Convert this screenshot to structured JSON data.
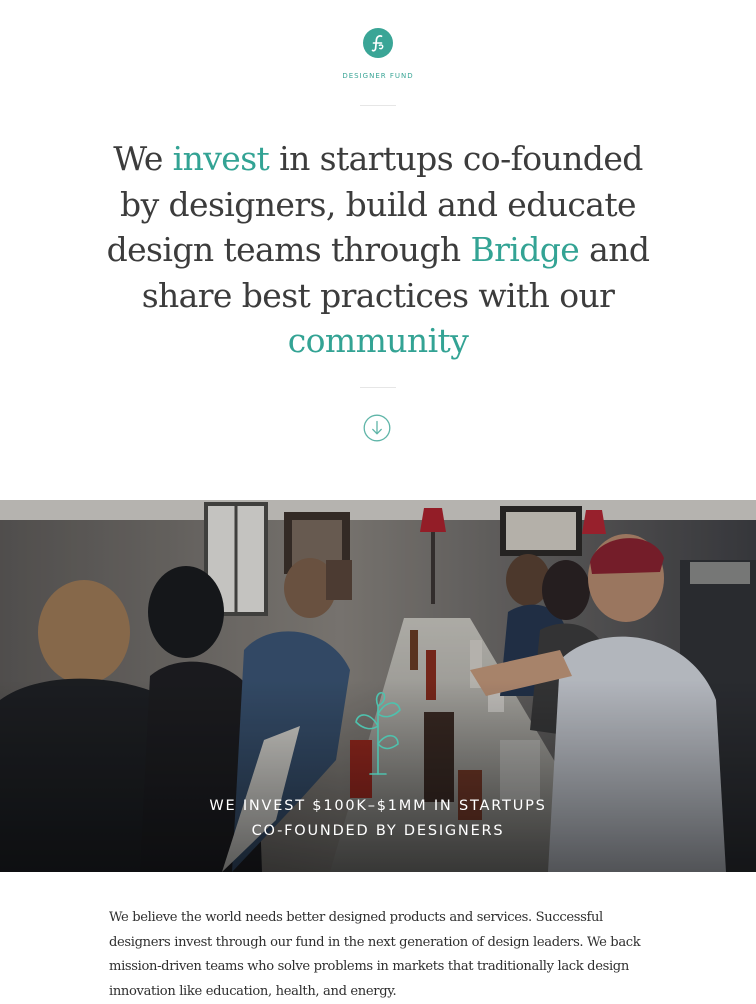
{
  "brand": {
    "name": "DESIGNER FUND",
    "logo_icon": "script-f-monogram-icon",
    "accent_color": "#3aa596"
  },
  "headline": {
    "part1": "We ",
    "hl1": "invest",
    "part2": " in startups co-founded by designers, build and educate design teams through ",
    "hl2": "Bridge",
    "part3": " and share best practices with our ",
    "hl3": "community"
  },
  "scroll": {
    "icon": "arrow-down-circle-icon"
  },
  "hero": {
    "caption_line1": "WE INVEST $100K–$1MM IN STARTUPS",
    "caption_line2": "CO-FOUNDED BY DESIGNERS",
    "icon": "sprouting-plant-icon"
  },
  "intro": {
    "text": "We believe the world needs better designed products and services. Successful designers invest through our fund in the next generation of design leaders. We back mission-driven teams who solve problems in markets that traditionally lack design innovation like education, health, and energy."
  }
}
